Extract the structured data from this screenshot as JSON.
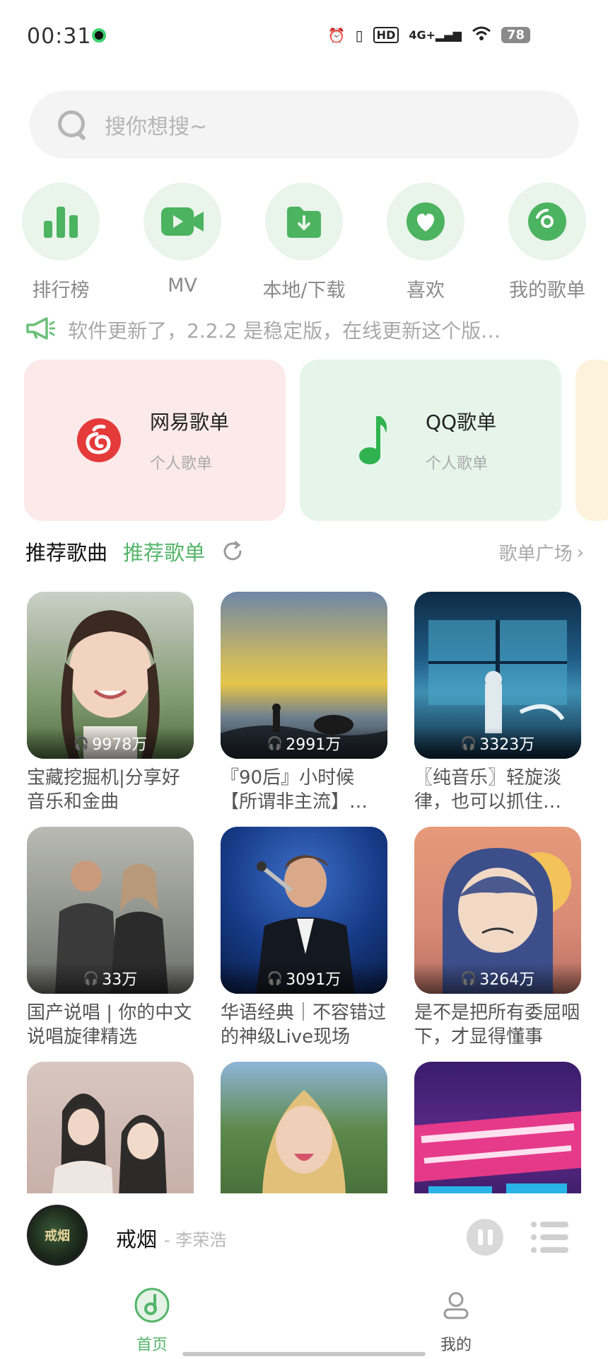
{
  "status_bar": {
    "time": "00:31",
    "hd": "HD",
    "network": "4G+",
    "battery": "78"
  },
  "search": {
    "placeholder": "搜你想搜~"
  },
  "quick_nav": [
    {
      "label": "排行榜",
      "icon": "bar-chart-icon"
    },
    {
      "label": "MV",
      "icon": "video-camera-icon"
    },
    {
      "label": "本地/下载",
      "icon": "download-folder-icon"
    },
    {
      "label": "喜欢",
      "icon": "heart-icon"
    },
    {
      "label": "我的歌单",
      "icon": "disc-icon"
    }
  ],
  "notice": {
    "text": "软件更新了，2.2.2 是稳定版，在线更新这个版…",
    "icon": "megaphone-icon"
  },
  "playlist_cards": [
    {
      "title": "网易歌单",
      "subtitle": "个人歌单",
      "icon": "netease-logo-icon",
      "bg": "#fce9e9",
      "accent": "#e43a3a"
    },
    {
      "title": "QQ歌单",
      "subtitle": "个人歌单",
      "icon": "music-note-icon",
      "bg": "#e6f5ea",
      "accent": "#2fb24f"
    }
  ],
  "section": {
    "tab_songs": "推荐歌曲",
    "tab_playlists": "推荐歌单",
    "square_link": "歌单广场",
    "accent": "#54b56a"
  },
  "playlists": [
    {
      "count": "9978万",
      "title": "宝藏挖掘机|分享好音乐和金曲"
    },
    {
      "count": "2991万",
      "title": "『90后』小时候【所谓非主流】…"
    },
    {
      "count": "3323万",
      "title": "〖纯音乐〗轻旋淡律，也可以抓住…"
    },
    {
      "count": "33万",
      "title": "国产说唱 | 你的中文说唱旋律精选"
    },
    {
      "count": "3091万",
      "title": "华语经典｜不容错过的神级Live现场"
    },
    {
      "count": "3264万",
      "title": "是不是把所有委屈咽下，才显得懂事"
    },
    {
      "count": "",
      "title": ""
    },
    {
      "count": "",
      "title": ""
    },
    {
      "count": "",
      "title": ""
    }
  ],
  "player": {
    "song": "戒烟",
    "artist": "- 李荣浩",
    "art_text": "戒烟"
  },
  "bottom_nav": {
    "home": "首页",
    "mine": "我的"
  }
}
